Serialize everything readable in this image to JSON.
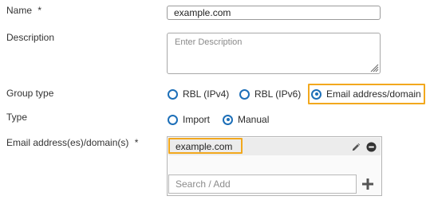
{
  "form": {
    "name": {
      "label": "Name",
      "required_mark": "*",
      "value": "example.com"
    },
    "description": {
      "label": "Description",
      "placeholder": "Enter Description"
    },
    "group_type": {
      "label": "Group type",
      "options": [
        {
          "label": "RBL (IPv4)",
          "checked": false
        },
        {
          "label": "RBL (IPv6)",
          "checked": false
        },
        {
          "label": "Email address/domain",
          "checked": true
        }
      ]
    },
    "type": {
      "label": "Type",
      "options": [
        {
          "label": "Import",
          "checked": false
        },
        {
          "label": "Manual",
          "checked": true
        }
      ]
    },
    "email_list": {
      "label": "Email address(es)/domain(s)",
      "required_mark": "*",
      "items": [
        "example.com"
      ],
      "search_placeholder": "Search / Add"
    }
  },
  "colors": {
    "accent": "#1d6fb8",
    "highlight": "#f2a81d"
  },
  "icons": {
    "edit": "pencil-icon",
    "remove": "remove-icon",
    "add": "plus-icon",
    "resize": "resize-grip-icon"
  }
}
